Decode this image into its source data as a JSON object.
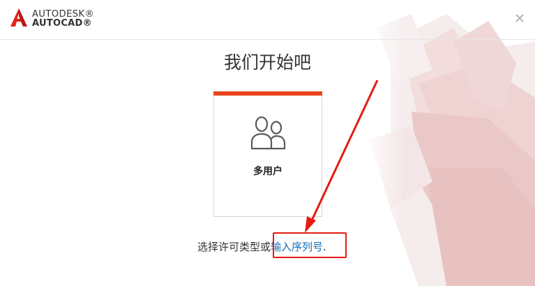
{
  "header": {
    "brand_line1": "AUTODESK®",
    "brand_line2": "AUTOCAD®",
    "close_icon": "close-icon"
  },
  "main": {
    "title": "我们开始吧",
    "card": {
      "label": "多用户",
      "icon": "users-icon"
    },
    "footer": {
      "prefix": "选择许可类型或",
      "link": "输入序列号",
      "suffix": "."
    }
  },
  "colors": {
    "accent": "#e8441d",
    "link": "#0f6fb7",
    "annotation": "#e51b12",
    "logo_red": "#e0251b"
  }
}
